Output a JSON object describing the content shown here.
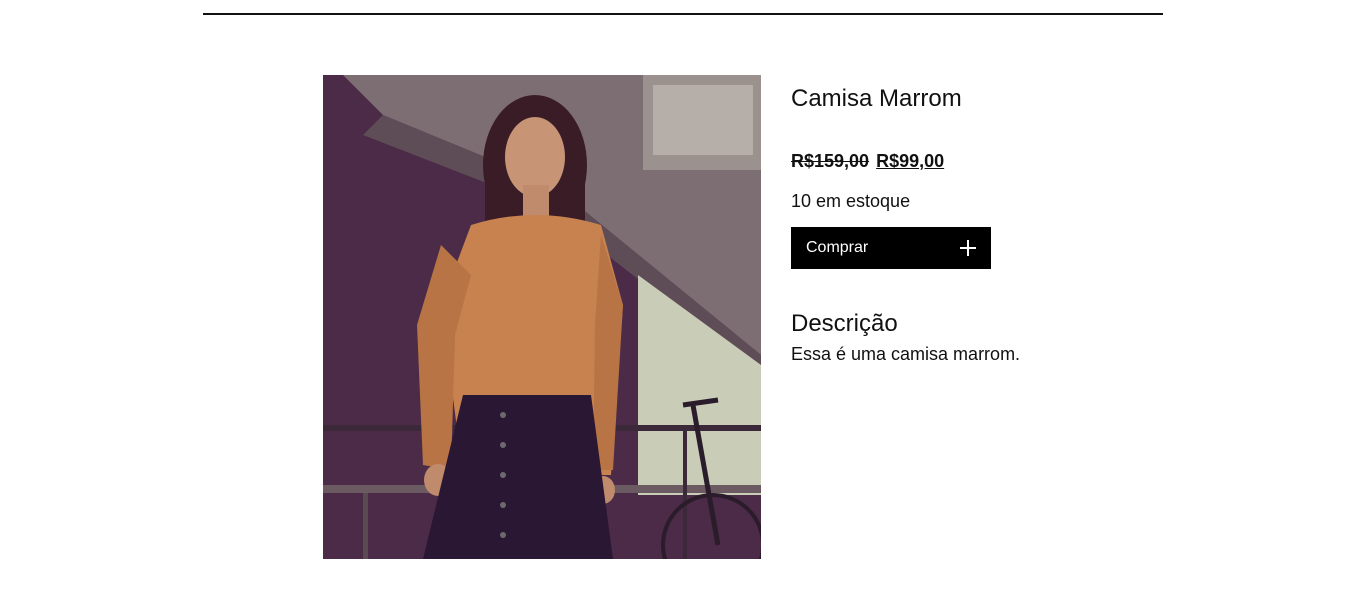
{
  "product": {
    "title": "Camisa Marrom",
    "price_old": "R$159,00",
    "price_new": "R$99,00",
    "stock": "10 em estoque",
    "buy_label": "Comprar",
    "buy_icon": "plus-icon",
    "description_heading": "Descrição",
    "description_text": "Essa é uma camisa marrom."
  },
  "colors": {
    "button_bg": "#000000",
    "button_text": "#ffffff",
    "text": "#111111"
  }
}
